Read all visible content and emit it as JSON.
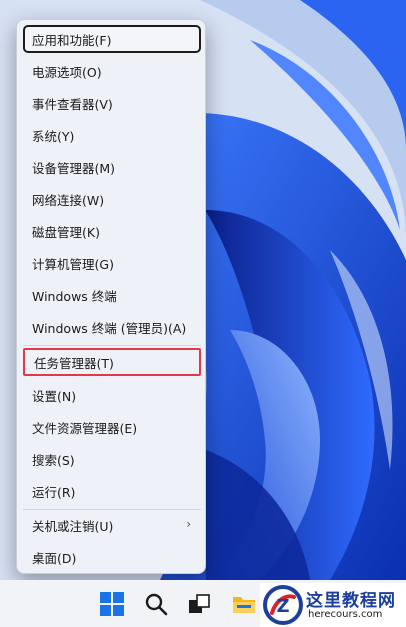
{
  "menu": {
    "items": [
      {
        "label": "应用和功能(F)"
      },
      {
        "label": "电源选项(O)"
      },
      {
        "label": "事件查看器(V)"
      },
      {
        "label": "系统(Y)"
      },
      {
        "label": "设备管理器(M)"
      },
      {
        "label": "网络连接(W)"
      },
      {
        "label": "磁盘管理(K)"
      },
      {
        "label": "计算机管理(G)"
      },
      {
        "label": "Windows 终端"
      },
      {
        "label": "Windows 终端 (管理员)(A)"
      },
      {
        "label": "任务管理器(T)"
      },
      {
        "label": "设置(N)"
      },
      {
        "label": "文件资源管理器(E)"
      },
      {
        "label": "搜索(S)"
      },
      {
        "label": "运行(R)"
      },
      {
        "label": "关机或注销(U)"
      },
      {
        "label": "桌面(D)"
      }
    ],
    "focused_item": "应用和功能(F)",
    "highlighted_item": "任务管理器(T)",
    "submenu_chevron": "›"
  },
  "taskbar": {
    "icons": [
      "start-windows-icon",
      "search-icon",
      "task-view-icon",
      "file-explorer-icon"
    ]
  },
  "watermark": {
    "title": "这里教程网",
    "url": "herecours.com"
  },
  "colors": {
    "wallpaper": "#1f4fd8",
    "menu_bg": "#eef1f7",
    "highlight_box": "#e03a4a",
    "watermark_text": "#1d3f9b"
  }
}
